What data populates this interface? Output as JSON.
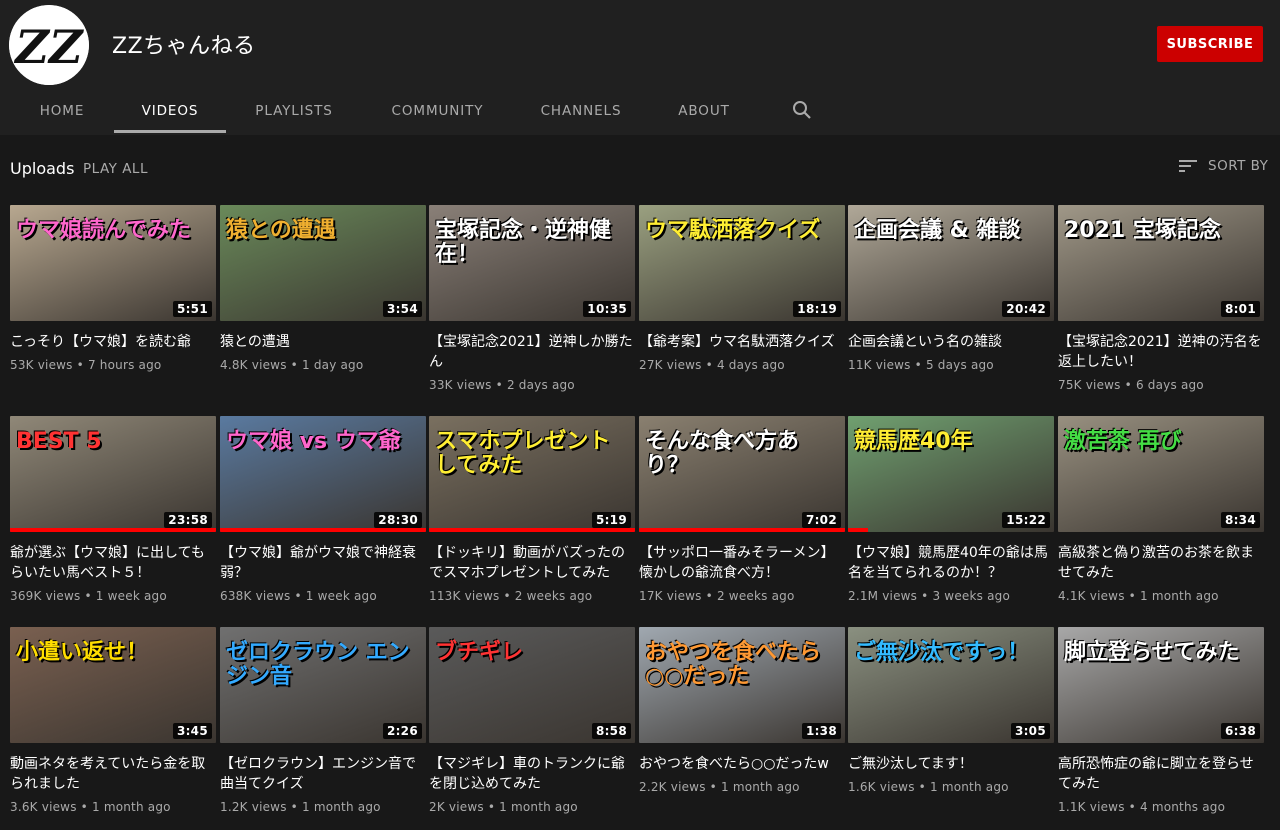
{
  "channel": {
    "name": "ZZちゃんねる",
    "avatar_text": "ZZ",
    "subscribe_label": "SUBSCRIBE"
  },
  "tabs": [
    {
      "label": "HOME"
    },
    {
      "label": "VIDEOS"
    },
    {
      "label": "PLAYLISTS"
    },
    {
      "label": "COMMUNITY"
    },
    {
      "label": "CHANNELS"
    },
    {
      "label": "ABOUT"
    }
  ],
  "active_tab": "VIDEOS",
  "section": {
    "title": "Uploads",
    "play_all": "PLAY ALL",
    "sort_by": "SORT BY"
  },
  "colors": {
    "accent": "#cc0000",
    "background": "#181818",
    "header": "#202020"
  },
  "videos": [
    {
      "title": "こっそり【ウマ娘】を読む爺",
      "views": "53K views",
      "age": "7 hours ago",
      "duration": "5:51",
      "overlay": "ウマ娘読んでみた",
      "overlay_color": "#ff66cc",
      "bg": "#b8a890"
    },
    {
      "title": "猿との遭遇",
      "views": "4.8K views",
      "age": "1 day ago",
      "duration": "3:54",
      "overlay": "猿との遭遇",
      "overlay_color": "#f0b030",
      "bg": "#6a8a5a"
    },
    {
      "title": "【宝塚記念2021】逆神しか勝たん",
      "views": "33K views",
      "age": "2 days ago",
      "duration": "10:35",
      "overlay": "宝塚記念・逆神健在！",
      "overlay_color": "#ffffff",
      "bg": "#8a8078"
    },
    {
      "title": "【爺考案】ウマ名駄洒落クイズ",
      "views": "27K views",
      "age": "4 days ago",
      "duration": "18:19",
      "overlay": "ウマ駄洒落クイズ",
      "overlay_color": "#ffee33",
      "bg": "#9aa080"
    },
    {
      "title": "企画会議という名の雑談",
      "views": "11K views",
      "age": "5 days ago",
      "duration": "20:42",
      "overlay": "企画会議 & 雑談",
      "overlay_color": "#ffffff",
      "bg": "#b0a898"
    },
    {
      "title": "【宝塚記念2021】逆神の汚名を返上したい！",
      "views": "75K views",
      "age": "6 days ago",
      "duration": "8:01",
      "overlay": "2021 宝塚記念",
      "overlay_color": "#ffffff",
      "bg": "#a09888"
    },
    {
      "title": "爺が選ぶ【ウマ娘】に出してもらいたい馬ベスト５！",
      "views": "369K views",
      "age": "1 week ago",
      "duration": "23:58",
      "overlay": "BEST 5",
      "overlay_color": "#ff3333",
      "bg": "#908878"
    },
    {
      "title": "【ウマ娘】爺がウマ娘で神経衰弱？",
      "views": "638K views",
      "age": "1 week ago",
      "duration": "28:30",
      "overlay": "ウマ娘 vs ウマ爺",
      "overlay_color": "#ff66cc",
      "bg": "#5a7aa0"
    },
    {
      "title": "【ドッキリ】動画がバズったのでスマホプレゼントしてみた",
      "views": "113K views",
      "age": "2 weeks ago",
      "duration": "5:19",
      "overlay": "スマホプレゼントしてみた",
      "overlay_color": "#ffee33",
      "bg": "#7a7060"
    },
    {
      "title": "【サッポロ一番みそラーメン】懐かしの爺流食べ方！",
      "views": "17K views",
      "age": "2 weeks ago",
      "duration": "7:02",
      "overlay": "そんな食べ方あり？",
      "overlay_color": "#ffffff",
      "bg": "#8a8070"
    },
    {
      "title": "【ウマ娘】競馬歴40年の爺は馬名を当てられるのか！？",
      "views": "2.1M views",
      "age": "3 weeks ago",
      "duration": "15:22",
      "overlay": "競馬歴40年",
      "overlay_color": "#ffee33",
      "bg": "#70a070"
    },
    {
      "title": "高級茶と偽り激苦のお茶を飲ませてみた",
      "views": "4.1K views",
      "age": "1 month ago",
      "duration": "8:34",
      "overlay": "激苦茶 再び",
      "overlay_color": "#44dd44",
      "bg": "#989080"
    },
    {
      "title": "動画ネタを考えていたら金を取られました",
      "views": "3.6K views",
      "age": "1 month ago",
      "duration": "3:45",
      "overlay": "小遣い返せ！",
      "overlay_color": "#ffdd00",
      "bg": "#7a6050"
    },
    {
      "title": "【ゼロクラウン】エンジン音で曲当てクイズ",
      "views": "1.2K views",
      "age": "1 month ago",
      "duration": "2:26",
      "overlay": "ゼロクラウン エンジン音",
      "overlay_color": "#33aaff",
      "bg": "#707070"
    },
    {
      "title": "【マジギレ】車のトランクに爺を閉じ込めてみた",
      "views": "2K views",
      "age": "1 month ago",
      "duration": "8:58",
      "overlay": "ブチギレ",
      "overlay_color": "#ff3333",
      "bg": "#5a5a5a"
    },
    {
      "title": "おやつを食べたら○○だったw",
      "views": "2.2K views",
      "age": "1 month ago",
      "duration": "1:38",
      "overlay": "おやつを食べたら○○だった",
      "overlay_color": "#ff9933",
      "bg": "#a0a8b0"
    },
    {
      "title": "ご無沙汰してます！",
      "views": "1.6K views",
      "age": "1 month ago",
      "duration": "3:05",
      "overlay": "ご無沙汰ですっ！",
      "overlay_color": "#33bbff",
      "bg": "#8a9080"
    },
    {
      "title": "高所恐怖症の爺に脚立を登らせてみた",
      "views": "1.1K views",
      "age": "4 months ago",
      "duration": "6:38",
      "overlay": "脚立登らせてみた",
      "overlay_color": "#ffffff",
      "bg": "#a8a8a8"
    }
  ]
}
